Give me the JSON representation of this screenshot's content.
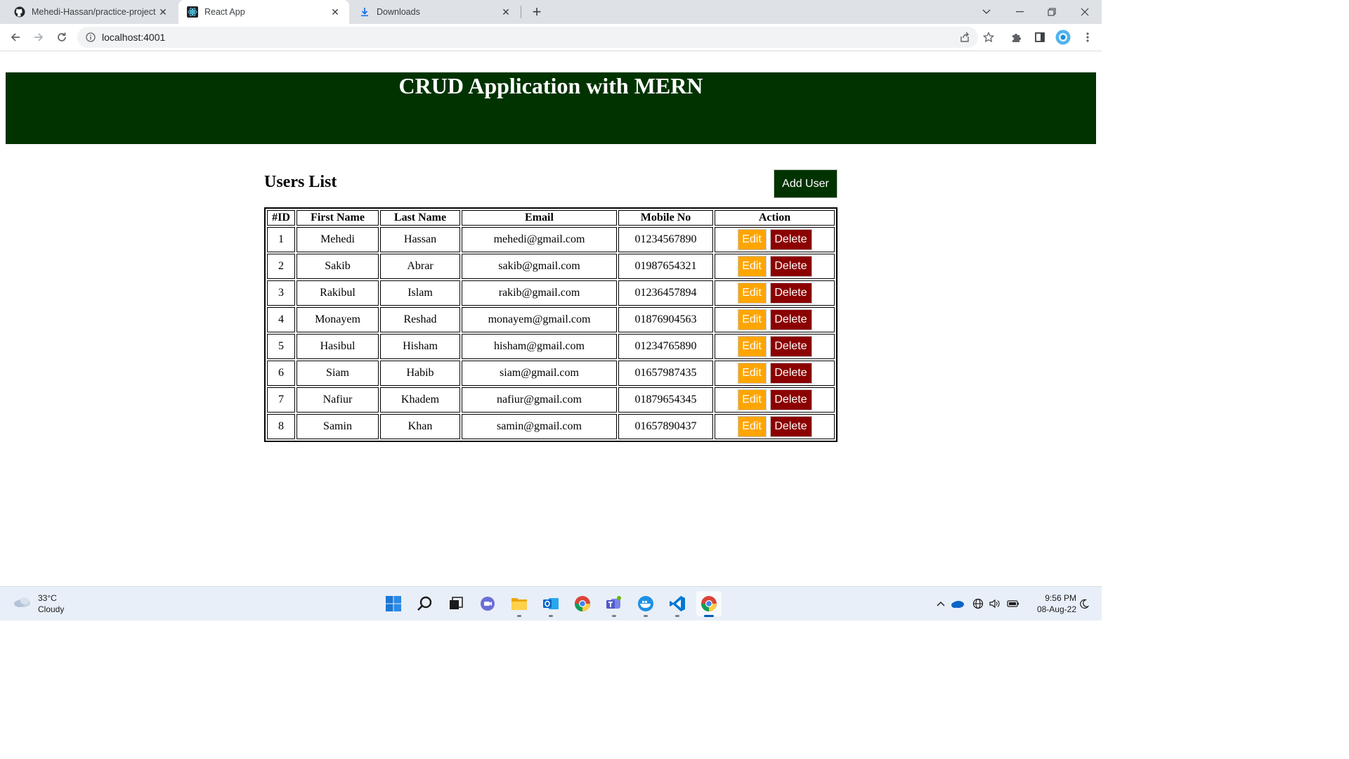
{
  "browser": {
    "tabs": [
      {
        "title": "Mehedi-Hassan/practice-project",
        "icon": "github-icon",
        "active": false
      },
      {
        "title": "React App",
        "icon": "react-icon",
        "active": true
      },
      {
        "title": "Downloads",
        "icon": "download-icon",
        "active": false
      }
    ],
    "address": "localhost:4001"
  },
  "page": {
    "header_title": "CRUD Application with MERN",
    "section_title": "Users List",
    "add_user_label": "Add User",
    "table": {
      "headers": [
        "#ID",
        "First Name",
        "Last Name",
        "Email",
        "Mobile No",
        "Action"
      ],
      "rows": [
        {
          "id": "1",
          "first": "Mehedi",
          "last": "Hassan",
          "email": "mehedi@gmail.com",
          "mobile": "01234567890"
        },
        {
          "id": "2",
          "first": "Sakib",
          "last": "Abrar",
          "email": "sakib@gmail.com",
          "mobile": "01987654321"
        },
        {
          "id": "3",
          "first": "Rakibul",
          "last": "Islam",
          "email": "rakib@gmail.com",
          "mobile": "01236457894"
        },
        {
          "id": "4",
          "first": "Monayem",
          "last": "Reshad",
          "email": "monayem@gmail.com",
          "mobile": "01876904563"
        },
        {
          "id": "5",
          "first": "Hasibul",
          "last": "Hisham",
          "email": "hisham@gmail.com",
          "mobile": "01234765890"
        },
        {
          "id": "6",
          "first": "Siam",
          "last": "Habib",
          "email": "siam@gmail.com",
          "mobile": "01657987435"
        },
        {
          "id": "7",
          "first": "Nafiur",
          "last": "Khadem",
          "email": "nafiur@gmail.com",
          "mobile": "01879654345"
        },
        {
          "id": "8",
          "first": "Samin",
          "last": "Khan",
          "email": "samin@gmail.com",
          "mobile": "01657890437"
        }
      ],
      "edit_label": "Edit",
      "delete_label": "Delete"
    }
  },
  "taskbar": {
    "weather_temp": "33°C",
    "weather_desc": "Cloudy",
    "time": "9:56 PM",
    "date": "08-Aug-22"
  },
  "colors": {
    "header_bg": "#003300",
    "add_button": "#003300",
    "edit_button": "#ffa500",
    "delete_button": "#8b0000"
  }
}
